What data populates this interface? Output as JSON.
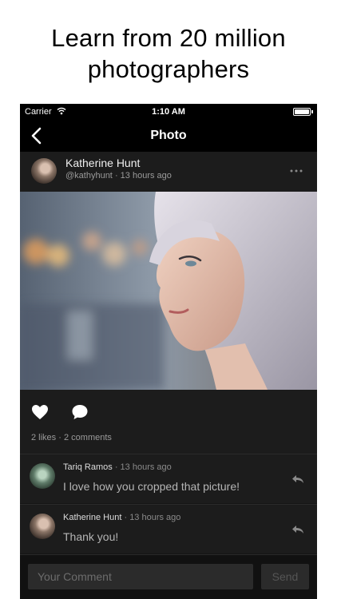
{
  "headline": {
    "line1": "Learn from 20 million",
    "line2": "photographers"
  },
  "status_bar": {
    "carrier": "Carrier",
    "time": "1:10 AM",
    "battery_percent": 100
  },
  "nav": {
    "title": "Photo",
    "back_icon": "chevron-left-icon"
  },
  "post": {
    "author_name": "Katherine Hunt",
    "author_handle": "@kathyhunt",
    "time_ago": "13 hours ago",
    "meta_separator": "·",
    "more_icon": "more-horizontal-icon"
  },
  "actions": {
    "likes_text": "2 likes",
    "comments_text": "2 comments",
    "separator": "·",
    "like_icon": "heart-icon",
    "comment_icon": "speech-bubble-icon"
  },
  "comments": [
    {
      "name": "Tariq Ramos",
      "time": "13 hours ago",
      "text": "I love how you cropped that picture!"
    },
    {
      "name": "Katherine Hunt",
      "time": "13 hours ago",
      "text": "Thank you!"
    }
  ],
  "composer": {
    "placeholder": "Your Comment",
    "send_label": "Send"
  }
}
